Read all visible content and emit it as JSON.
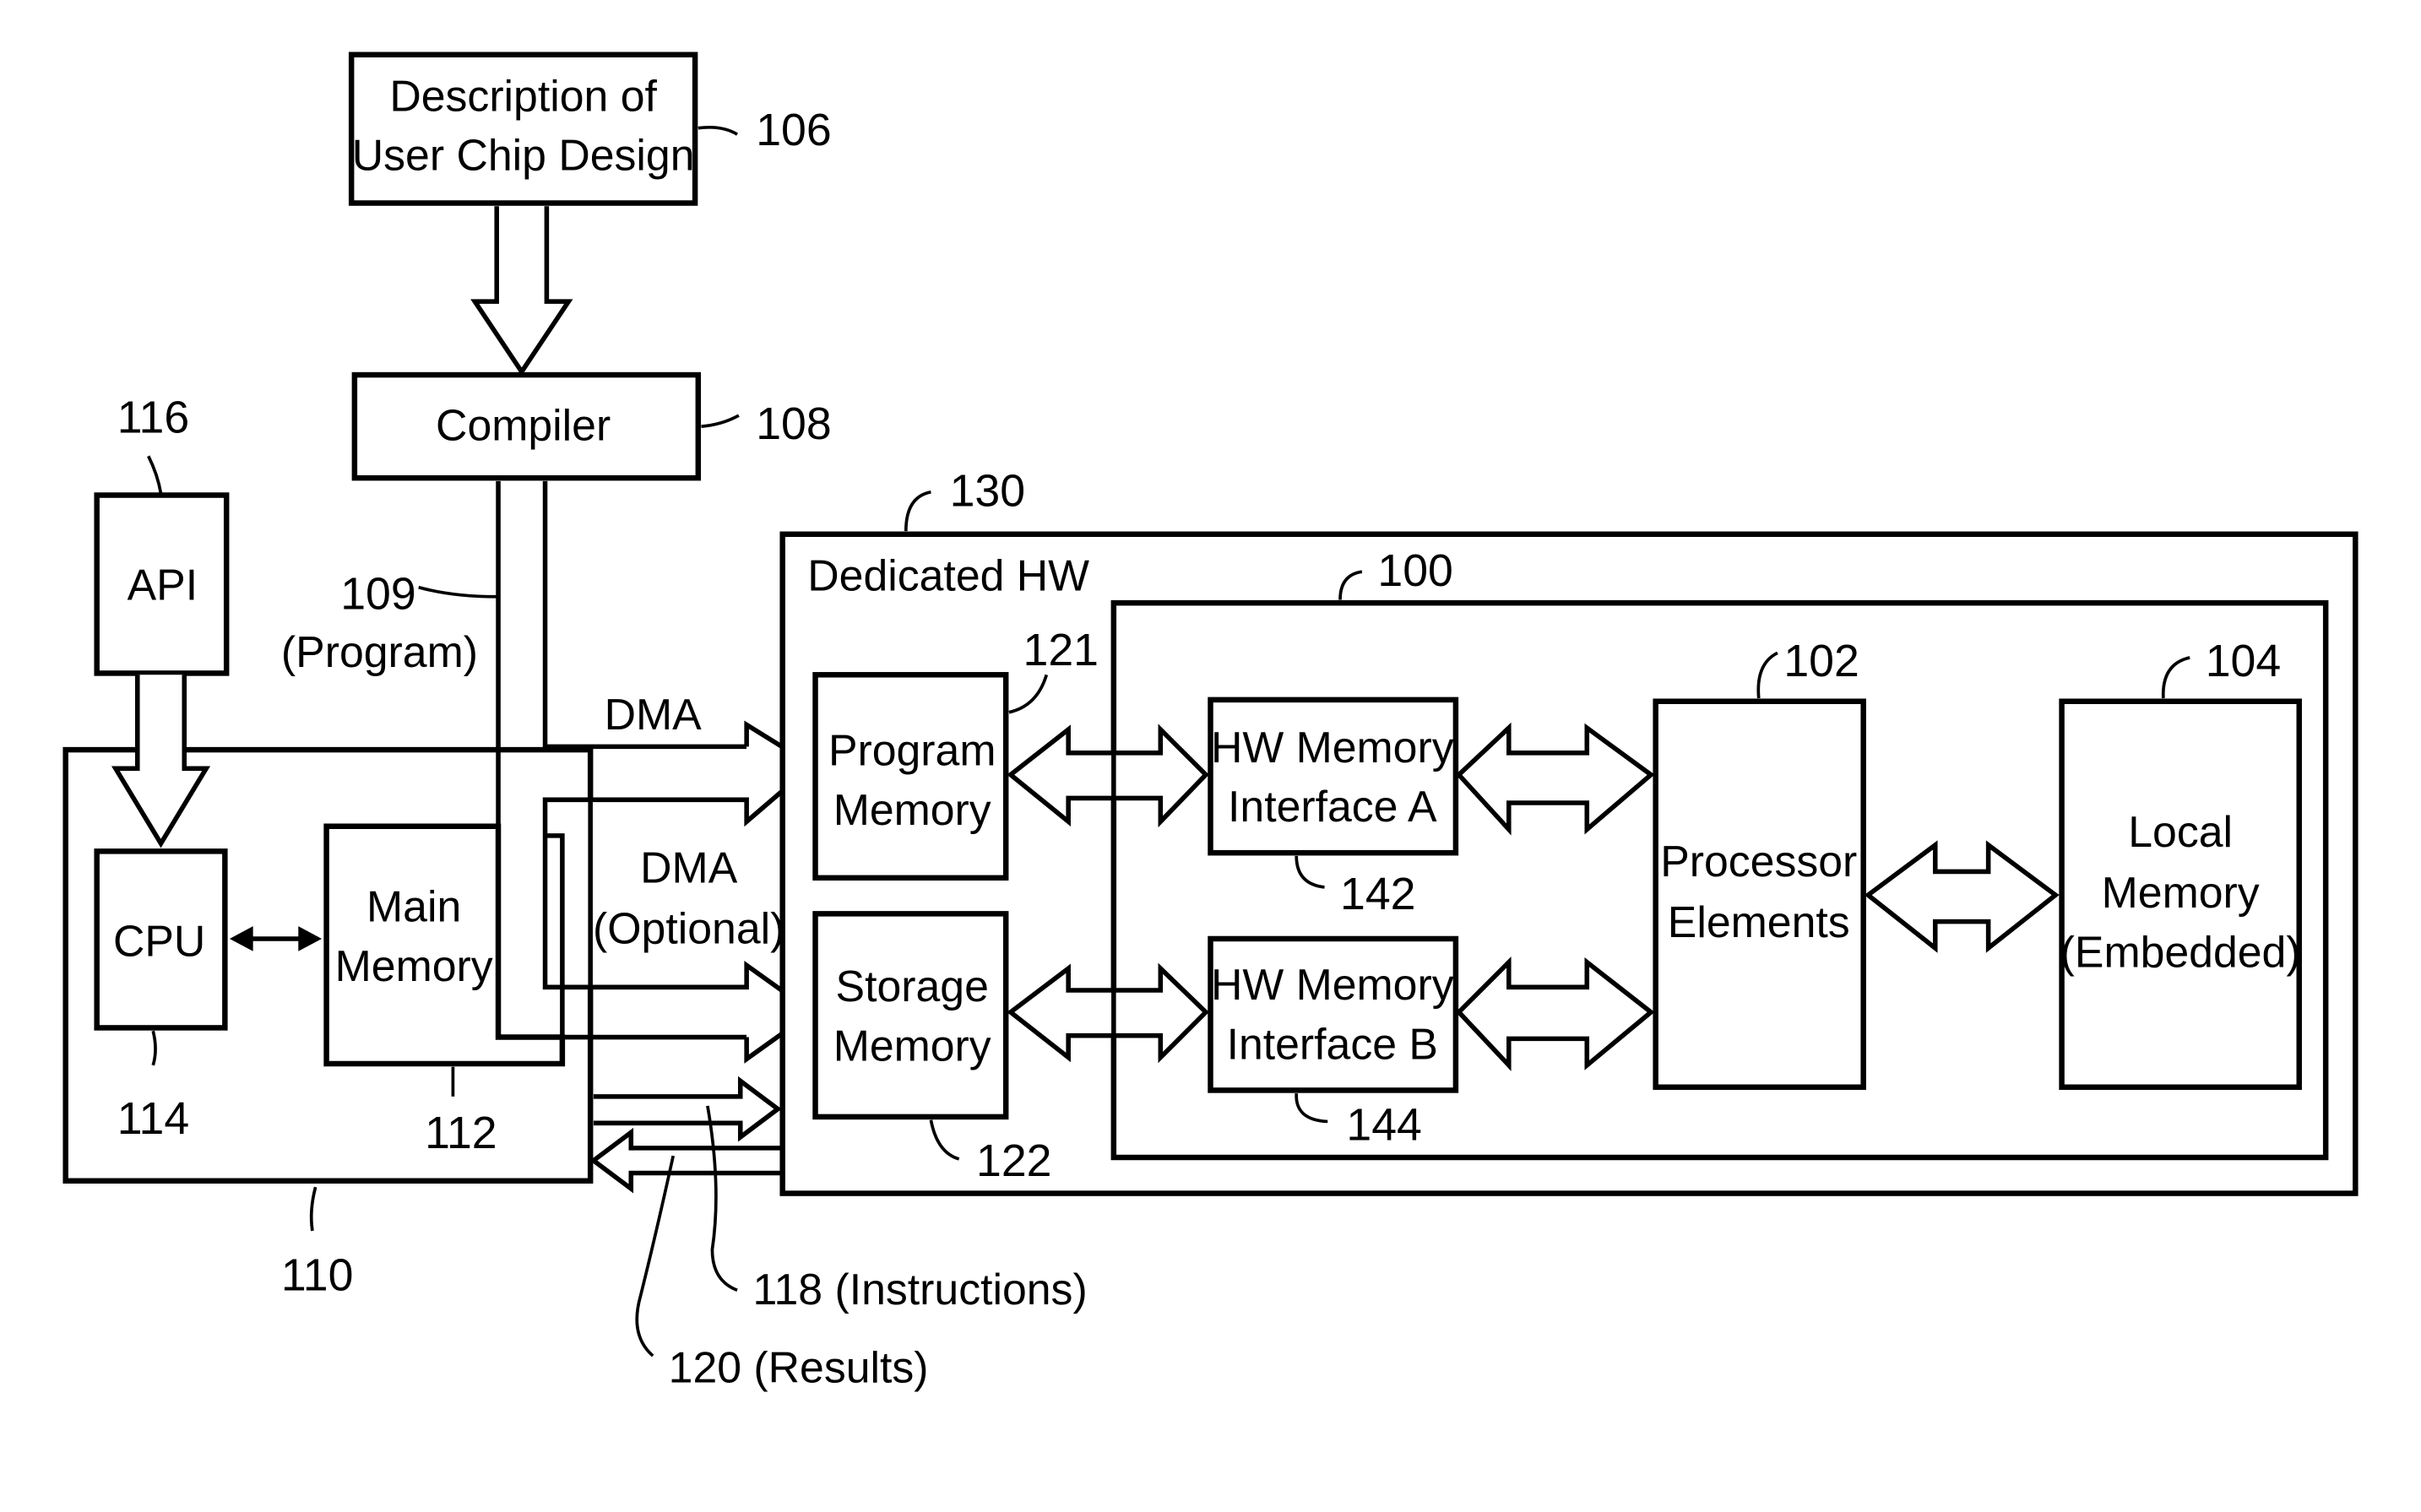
{
  "figure": {
    "blocks": {
      "description": {
        "line1": "Description of",
        "line2": "User Chip Design",
        "ref": "106"
      },
      "compiler": {
        "label": "Compiler",
        "ref": "108"
      },
      "program_path": {
        "ref": "109",
        "label": "(Program)"
      },
      "api": {
        "label": "API",
        "ref": "116"
      },
      "host": {
        "ref": "110"
      },
      "cpu": {
        "label": "CPU",
        "ref": "114"
      },
      "main_memory": {
        "line1": "Main",
        "line2": "Memory",
        "ref": "112"
      },
      "dma": {
        "label": "DMA"
      },
      "dma_optional": {
        "line1": "DMA",
        "line2": "(Optional)"
      },
      "dedicated_hw": {
        "label": "Dedicated HW",
        "ref": "130"
      },
      "chip": {
        "ref": "100"
      },
      "program_memory": {
        "line1": "Program",
        "line2": "Memory",
        "ref": "121"
      },
      "storage_memory": {
        "line1": "Storage",
        "line2": "Memory",
        "ref": "122"
      },
      "hw_mem_a": {
        "line1": "HW Memory",
        "line2": "Interface A",
        "ref": "142"
      },
      "hw_mem_b": {
        "line1": "HW Memory",
        "line2": "Interface B",
        "ref": "144"
      },
      "processor": {
        "line1": "Processor",
        "line2": "Elements",
        "ref": "102"
      },
      "local_memory": {
        "line1": "Local",
        "line2": "Memory",
        "line3": "(Embedded)",
        "ref": "104"
      },
      "instructions": {
        "label": "118 (Instructions)"
      },
      "results": {
        "label": "120 (Results)"
      }
    }
  }
}
